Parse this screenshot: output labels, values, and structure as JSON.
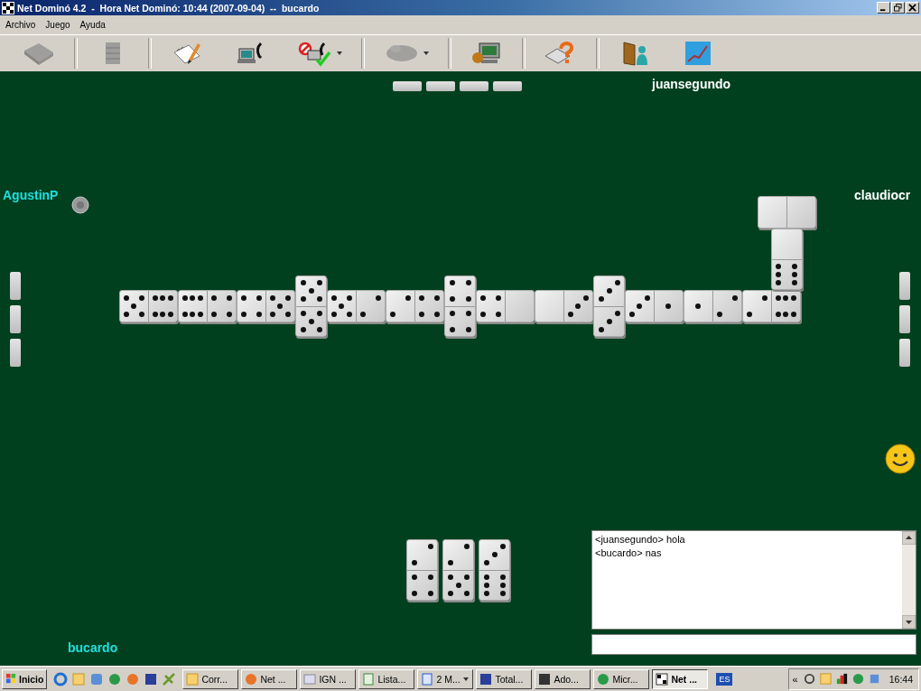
{
  "window": {
    "title": "Net Dominó 4.2  -  Hora Net Dominó: 10:44 (2007-09-04)  --  bucardo"
  },
  "menu": [
    "Archivo",
    "Juego",
    "Ayuda"
  ],
  "toolbar": [
    {
      "kind": "tile",
      "disabled": true,
      "dropdown": false
    },
    {
      "kind": "stack",
      "disabled": true,
      "dropdown": false
    },
    {
      "kind": "notepad",
      "disabled": false,
      "dropdown": false
    },
    {
      "kind": "phone",
      "disabled": false,
      "dropdown": false
    },
    {
      "kind": "phonecheck",
      "disabled": false,
      "dropdown": true
    },
    {
      "kind": "blob",
      "disabled": true,
      "dropdown": true
    },
    {
      "kind": "computer",
      "disabled": false,
      "dropdown": false
    },
    {
      "kind": "help",
      "disabled": false,
      "dropdown": false
    },
    {
      "kind": "door",
      "disabled": false,
      "dropdown": false
    },
    {
      "kind": "chart",
      "disabled": false,
      "dropdown": false
    }
  ],
  "players": [
    {
      "kind": "top",
      "name": "juansegundo",
      "color": "#ffffff",
      "hidden_tiles": [
        {
          "kind": "face_down"
        },
        {
          "kind": "face_down"
        },
        {
          "kind": "face_down"
        },
        {
          "kind": "face_down"
        }
      ]
    },
    {
      "kind": "left",
      "name": "AgustinP",
      "color": "#22dede",
      "hidden_tiles": [
        {
          "kind": "face_down"
        },
        {
          "kind": "face_down"
        },
        {
          "kind": "face_down"
        }
      ]
    },
    {
      "kind": "right",
      "name": "claudiocr",
      "color": "#ffffff",
      "hidden_tiles": [
        {
          "kind": "face_down"
        },
        {
          "kind": "face_down"
        },
        {
          "kind": "face_down"
        }
      ]
    },
    {
      "kind": "bottom",
      "name": "bucardo",
      "color": "#22dede"
    }
  ],
  "chain": [
    {
      "kind": "across",
      "halves": [
        {
          "kind": "five"
        },
        {
          "kind": "six"
        }
      ]
    },
    {
      "kind": "across",
      "halves": [
        {
          "kind": "six"
        },
        {
          "kind": "four"
        }
      ]
    },
    {
      "kind": "across",
      "halves": [
        {
          "kind": "four"
        },
        {
          "kind": "five"
        }
      ]
    },
    {
      "kind": "upright",
      "halves": [
        {
          "kind": "five"
        },
        {
          "kind": "five"
        }
      ]
    },
    {
      "kind": "across",
      "halves": [
        {
          "kind": "five"
        },
        {
          "kind": "two"
        }
      ]
    },
    {
      "kind": "across",
      "halves": [
        {
          "kind": "two"
        },
        {
          "kind": "four"
        }
      ]
    },
    {
      "kind": "upright",
      "halves": [
        {
          "kind": "four"
        },
        {
          "kind": "four"
        }
      ]
    },
    {
      "kind": "across",
      "halves": [
        {
          "kind": "four"
        },
        {
          "kind": "blank"
        }
      ]
    },
    {
      "kind": "across",
      "halves": [
        {
          "kind": "blank"
        },
        {
          "kind": "three"
        }
      ]
    },
    {
      "kind": "upright",
      "halves": [
        {
          "kind": "three"
        },
        {
          "kind": "three"
        }
      ]
    },
    {
      "kind": "across",
      "halves": [
        {
          "kind": "three"
        },
        {
          "kind": "one"
        }
      ]
    },
    {
      "kind": "across",
      "halves": [
        {
          "kind": "one"
        },
        {
          "kind": "two"
        }
      ]
    },
    {
      "kind": "across",
      "halves": [
        {
          "kind": "two"
        },
        {
          "kind": "six"
        }
      ]
    }
  ],
  "branch": [
    {
      "kind": "upright",
      "halves": [
        {
          "kind": "blank"
        },
        {
          "kind": "six"
        }
      ]
    },
    {
      "kind": "across",
      "halves": [
        {
          "kind": "blank"
        },
        {
          "kind": "blank"
        }
      ]
    }
  ],
  "hand": [
    {
      "kind": "upright",
      "halves": [
        {
          "kind": "two"
        },
        {
          "kind": "four"
        }
      ]
    },
    {
      "kind": "upright",
      "halves": [
        {
          "kind": "two"
        },
        {
          "kind": "five"
        }
      ]
    },
    {
      "kind": "upright",
      "halves": [
        {
          "kind": "three"
        },
        {
          "kind": "six"
        }
      ]
    }
  ],
  "chat": {
    "lines": [
      "<juansegundo> hola",
      "<bucardo> nas"
    ]
  },
  "taskbar": {
    "start": "Inicio",
    "quick_launch": [
      {
        "kind": "ie"
      },
      {
        "kind": "clock"
      },
      {
        "kind": "chat"
      },
      {
        "kind": "globe"
      },
      {
        "kind": "firefox"
      },
      {
        "kind": "disk"
      },
      {
        "kind": "tool"
      }
    ],
    "tasks": [
      {
        "label": "Corr...",
        "kind": "clock",
        "selected": false,
        "dropdown": false
      },
      {
        "label": "Net ...",
        "kind": "firefox",
        "selected": false,
        "dropdown": false
      },
      {
        "label": "IGN ...",
        "kind": "window",
        "selected": false,
        "dropdown": false
      },
      {
        "label": "Lista...",
        "kind": "sheet",
        "selected": false,
        "dropdown": false
      },
      {
        "label": "2 M...",
        "kind": "doc",
        "selected": false,
        "dropdown": true
      },
      {
        "label": "Total...",
        "kind": "disk",
        "selected": false,
        "dropdown": false
      },
      {
        "label": "Ado...",
        "kind": "film",
        "selected": false,
        "dropdown": false
      },
      {
        "label": "Micr...",
        "kind": "globe",
        "selected": false,
        "dropdown": false
      },
      {
        "label": "Net ...",
        "kind": "domino",
        "selected": true,
        "dropdown": false
      }
    ],
    "language": "ES",
    "tray_expand": "«",
    "clock": "16:44"
  }
}
